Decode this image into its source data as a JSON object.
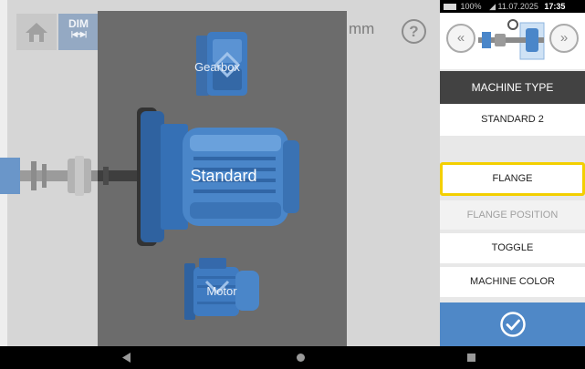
{
  "toolbar": {
    "dim_label": "DIM",
    "unit_label": "mm",
    "help_label": "?"
  },
  "machines": {
    "gearbox_label": "Gearbox",
    "standard_label": "Standard",
    "motor_label": "Motor"
  },
  "status_bar": {
    "battery": "100%",
    "date": "11.07.2025",
    "time": "17:35"
  },
  "panel": {
    "header": "MACHINE TYPE",
    "selected_type": "STANDARD 2",
    "options": {
      "flange": "FLANGE",
      "flange_position": "FLANGE POSITION",
      "toggle": "TOGGLE",
      "machine_color": "MACHINE COLOR"
    }
  },
  "icons": {
    "home": "home-icon",
    "dim": "dimension-arrows-icon",
    "help": "help-icon",
    "prev": "chevron-double-left-icon",
    "next": "chevron-double-right-icon",
    "confirm": "checkmark-circle-icon",
    "back": "triangle-back-icon",
    "nav_home": "circle-home-icon",
    "recent": "square-recent-icon"
  },
  "colors": {
    "machine_blue": "#3f7bc1",
    "panel_header": "#424242",
    "selection_highlight": "#f3cf00",
    "confirm_button": "#4f88c7",
    "dim_button": "#94a9c3"
  }
}
